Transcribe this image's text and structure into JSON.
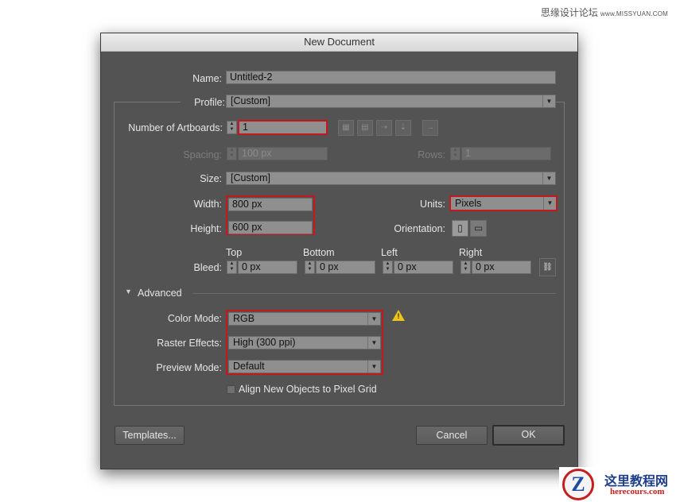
{
  "watermark_top": {
    "site_cn": "思缘设计论坛",
    "site_en": "www.MISSYUAN.COM"
  },
  "watermark_bottom": {
    "logo_letter": "Z",
    "name_cn": "这里教程网",
    "domain": "herecours.com"
  },
  "dialog": {
    "title": "New Document",
    "name": {
      "label": "Name:",
      "value": "Untitled-2"
    },
    "profile": {
      "label": "Profile:",
      "value": "[Custom]"
    },
    "artboards": {
      "label": "Number of Artboards:",
      "value": "1"
    },
    "spacing": {
      "label": "Spacing:",
      "value": "100 px"
    },
    "rows": {
      "label": "Rows:",
      "value": "1"
    },
    "size": {
      "label": "Size:",
      "value": "[Custom]"
    },
    "width": {
      "label": "Width:",
      "value": "800 px"
    },
    "height": {
      "label": "Height:",
      "value": "600 px"
    },
    "units": {
      "label": "Units:",
      "value": "Pixels"
    },
    "orientation": {
      "label": "Orientation:"
    },
    "bleed": {
      "label": "Bleed:",
      "top": {
        "label": "Top",
        "value": "0 px"
      },
      "bottom": {
        "label": "Bottom",
        "value": "0 px"
      },
      "left": {
        "label": "Left",
        "value": "0 px"
      },
      "right": {
        "label": "Right",
        "value": "0 px"
      }
    },
    "advanced": {
      "label": "Advanced"
    },
    "color_mode": {
      "label": "Color Mode:",
      "value": "RGB"
    },
    "raster_effects": {
      "label": "Raster Effects:",
      "value": "High (300 ppi)"
    },
    "preview_mode": {
      "label": "Preview Mode:",
      "value": "Default"
    },
    "align_pixel_grid": {
      "label": "Align New Objects to Pixel Grid",
      "checked": false
    },
    "buttons": {
      "templates": "Templates...",
      "cancel": "Cancel",
      "ok": "OK"
    }
  },
  "colors": {
    "highlight": "#c8161d",
    "dialog_bg": "#535353",
    "warning": "#f0c419"
  }
}
